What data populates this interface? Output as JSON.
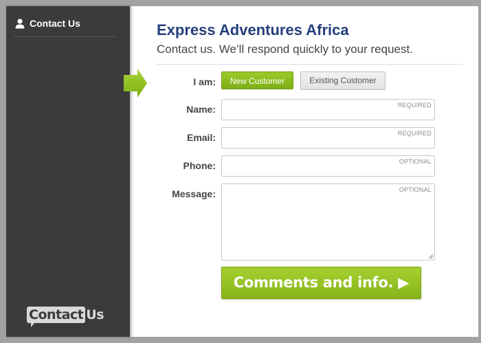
{
  "sidebar": {
    "tab_label": "Contact Us",
    "tab_icon": "person-icon",
    "brand": {
      "left": "Contact",
      "right": "Us"
    }
  },
  "header": {
    "title": "Express Adventures Africa",
    "subtitle": "Contact us. We’ll respond quickly to your request."
  },
  "form": {
    "iam_label": "I am:",
    "customer_options": [
      "New Customer",
      "Existing Customer"
    ],
    "selected_option": "New Customer",
    "fields": {
      "name": {
        "label": "Name:",
        "tag": "REQUIRED",
        "value": ""
      },
      "email": {
        "label": "Email:",
        "tag": "REQUIRED",
        "value": ""
      },
      "phone": {
        "label": "Phone:",
        "tag": "OPTIONAL",
        "value": ""
      },
      "message": {
        "label": "Message:",
        "tag": "OPTIONAL",
        "value": ""
      }
    },
    "submit_label": "Comments and info. ▶"
  },
  "colors": {
    "title": "#253f7b",
    "accent_green": "#8dbd1f",
    "sidebar_bg": "#3b3b3b"
  }
}
